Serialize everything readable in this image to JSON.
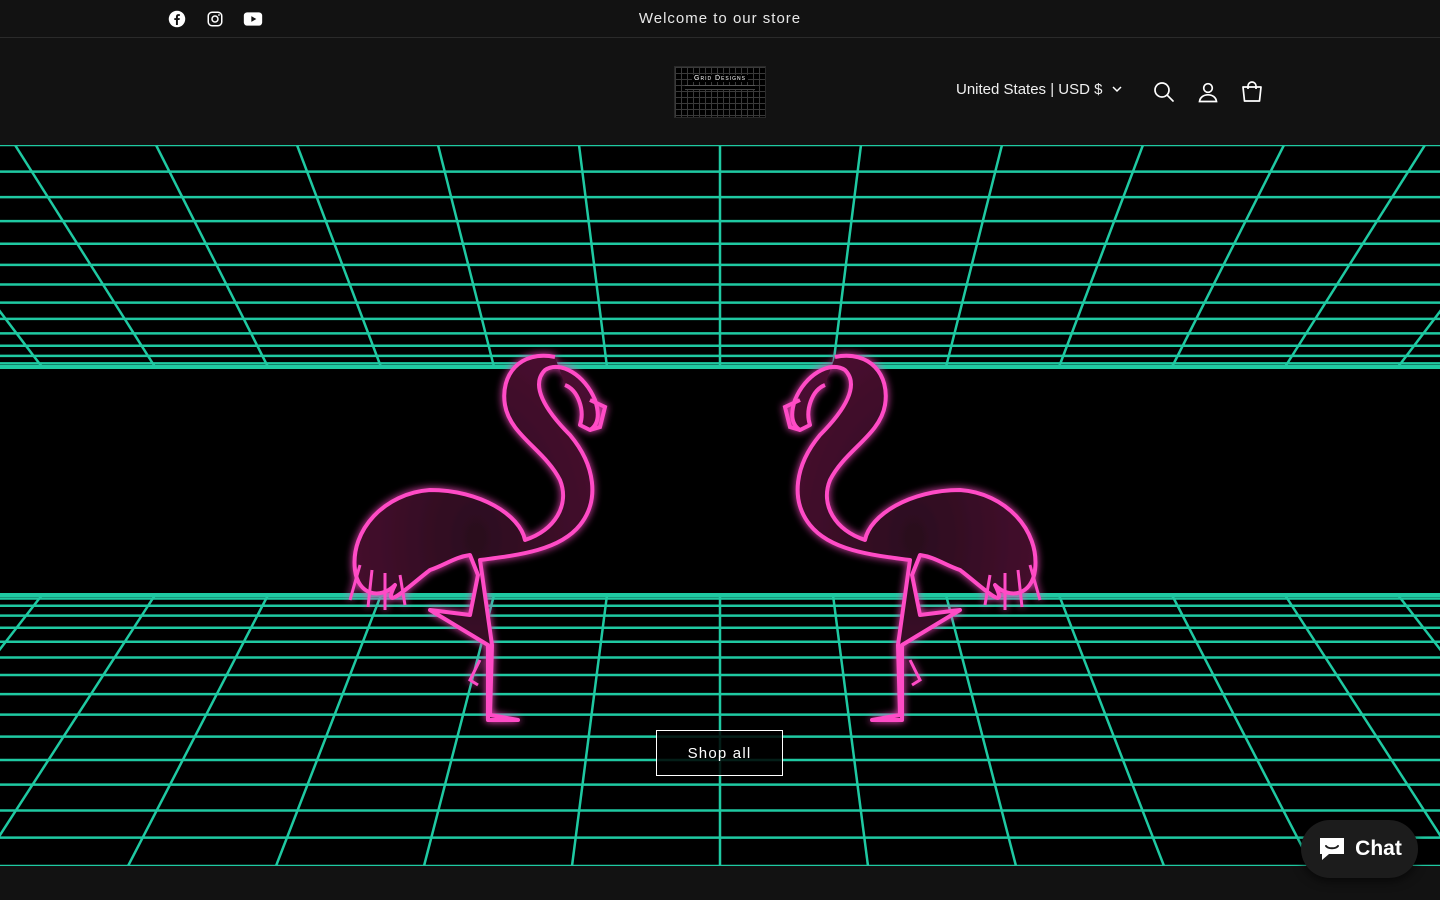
{
  "announcement": {
    "text": "Welcome to our store",
    "social": [
      {
        "name": "facebook-icon"
      },
      {
        "name": "instagram-icon"
      },
      {
        "name": "youtube-icon"
      }
    ]
  },
  "header": {
    "logo_text": "Grid Designs",
    "country_selector": "United States | USD $",
    "icons": [
      "search-icon",
      "account-icon",
      "cart-icon"
    ]
  },
  "hero": {
    "button_label": "Shop all",
    "grid_color": "#1fc9a2",
    "neon_color": "#ff3fbf"
  },
  "chat": {
    "label": "Chat"
  }
}
